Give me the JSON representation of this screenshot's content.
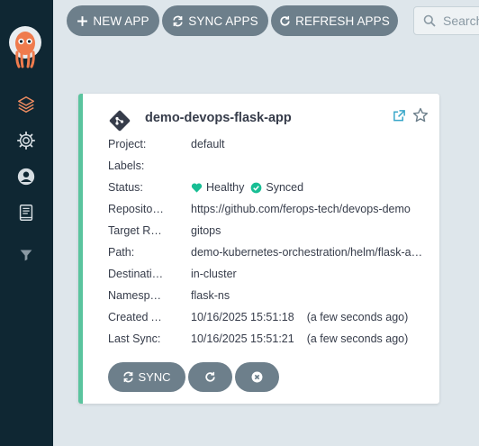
{
  "toolbar": {
    "new_app": "NEW APP",
    "sync_apps": "SYNC APPS",
    "refresh_apps": "REFRESH APPS",
    "search_placeholder": "Search"
  },
  "sidebar": {
    "icons": [
      "argo-logo-icon",
      "applications-icon",
      "settings-icon",
      "user-icon",
      "docs-icon",
      "filter-icon"
    ]
  },
  "app": {
    "name": "demo-devops-flask-app",
    "rows": [
      {
        "label": "Project:",
        "value": "default"
      },
      {
        "label": "Labels:",
        "value": ""
      },
      {
        "label": "Status:",
        "health": "Healthy",
        "sync": "Synced"
      },
      {
        "label": "Repository:",
        "value": "https://github.com/ferops-tech/devops-demo"
      },
      {
        "label": "Target Revision:",
        "value": "gitops"
      },
      {
        "label": "Path:",
        "value": "demo-kubernetes-orchestration/helm/flask-app"
      },
      {
        "label": "Destination:",
        "value": "in-cluster"
      },
      {
        "label": "Namespace:",
        "value": "flask-ns"
      },
      {
        "label": "Created At:",
        "value": "10/16/2025 15:51:18",
        "sub": "(a few seconds ago)"
      },
      {
        "label": "Last Sync:",
        "value": "10/16/2025 15:51:21",
        "sub": "(a few seconds ago)"
      }
    ],
    "actions": {
      "sync": "SYNC"
    }
  },
  "colors": {
    "sidebar": "#0f2733",
    "button": "#6d7f8b",
    "healthy": "#18be94",
    "accent": "#5ac49e",
    "link": "#0dadea"
  }
}
